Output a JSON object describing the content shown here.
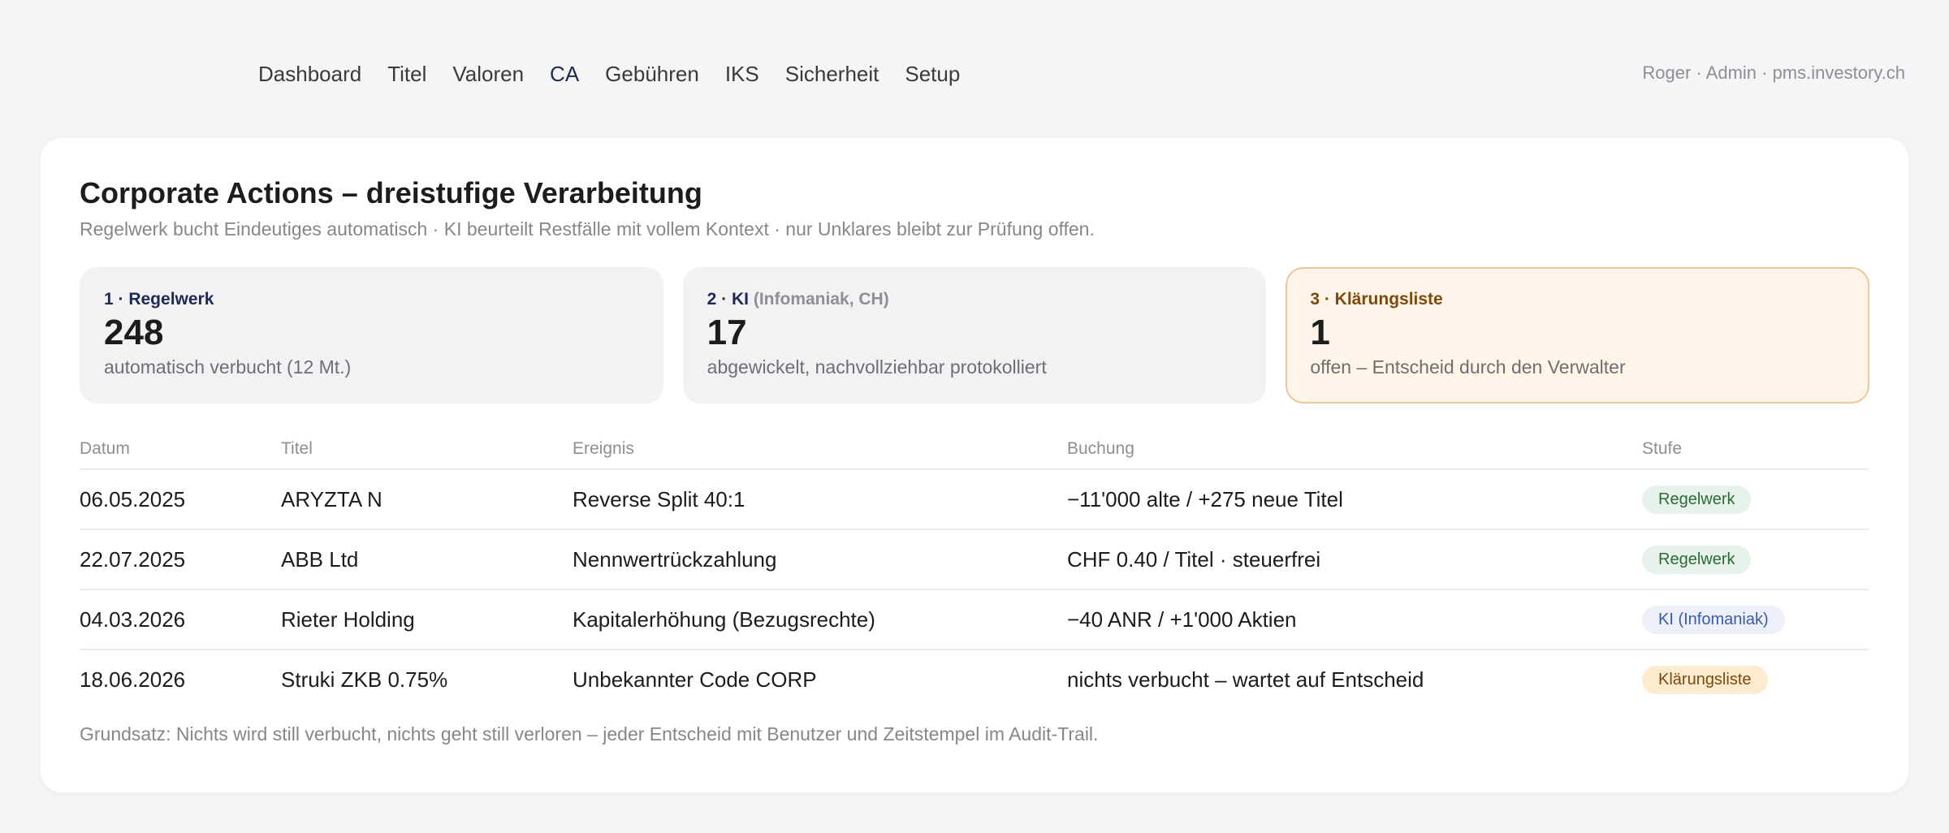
{
  "nav": {
    "items": [
      {
        "label": "Dashboard",
        "active": false
      },
      {
        "label": "Titel",
        "active": false
      },
      {
        "label": "Valoren",
        "active": false
      },
      {
        "label": "CA",
        "active": true
      },
      {
        "label": "Gebühren",
        "active": false
      },
      {
        "label": "IKS",
        "active": false
      },
      {
        "label": "Sicherheit",
        "active": false
      },
      {
        "label": "Setup",
        "active": false
      }
    ]
  },
  "user_info": "Roger · Admin · pms.investory.ch",
  "main": {
    "title": "Corporate Actions – dreistufige Verarbeitung",
    "subtitle": "Regelwerk bucht Eindeutiges automatisch · KI beurteilt Restfälle mit vollem Kontext · nur Unklares bleibt zur Prüfung offen.",
    "stages": [
      {
        "label": "1 · Regelwerk",
        "label_suffix": "",
        "value": "248",
        "desc": "automatisch verbucht (12 Mt.)"
      },
      {
        "label": "2 · KI",
        "label_suffix": "(Infomaniak, CH)",
        "value": "17",
        "desc": "abgewickelt, nachvollziehbar protokolliert"
      },
      {
        "label": "3 · Klärungsliste",
        "label_suffix": "",
        "value": "1",
        "desc": "offen – Entscheid durch den Verwalter"
      }
    ],
    "table": {
      "headers": {
        "date": "Datum",
        "title": "Titel",
        "event": "Ereignis",
        "booking": "Buchung",
        "stage": "Stufe"
      },
      "rows": [
        {
          "date": "06.05.2025",
          "title": "ARYZTA N",
          "event": "Reverse Split 40:1",
          "booking": "−11'000 alte / +275 neue Titel",
          "stage": "Regelwerk"
        },
        {
          "date": "22.07.2025",
          "title": "ABB Ltd",
          "event": "Nennwertrückzahlung",
          "booking": "CHF 0.40 / Titel · steuerfrei",
          "stage": "Regelwerk"
        },
        {
          "date": "04.03.2026",
          "title": "Rieter Holding",
          "event": "Kapitalerhöhung (Bezugsrechte)",
          "booking": "−40 ANR / +1'000 Aktien",
          "stage": "KI (Infomaniak)"
        },
        {
          "date": "18.06.2026",
          "title": "Struki ZKB 0.75%",
          "event": "Unbekannter Code CORP",
          "booking": "nichts verbucht – wartet auf Entscheid",
          "stage": "Klärungsliste"
        }
      ]
    },
    "footer_note": "Grundsatz: Nichts wird still verbucht, nichts geht still verloren – jeder Entscheid mit Benutzer und Zeitstempel im Audit-Trail."
  },
  "colors": {
    "accent_navy": "#1f2a52",
    "badge_regelwerk": "#e7f3ea",
    "badge_ki": "#edf0f9",
    "badge_klaerung": "#fcebcf",
    "highlight_card": "#fef4e7"
  }
}
